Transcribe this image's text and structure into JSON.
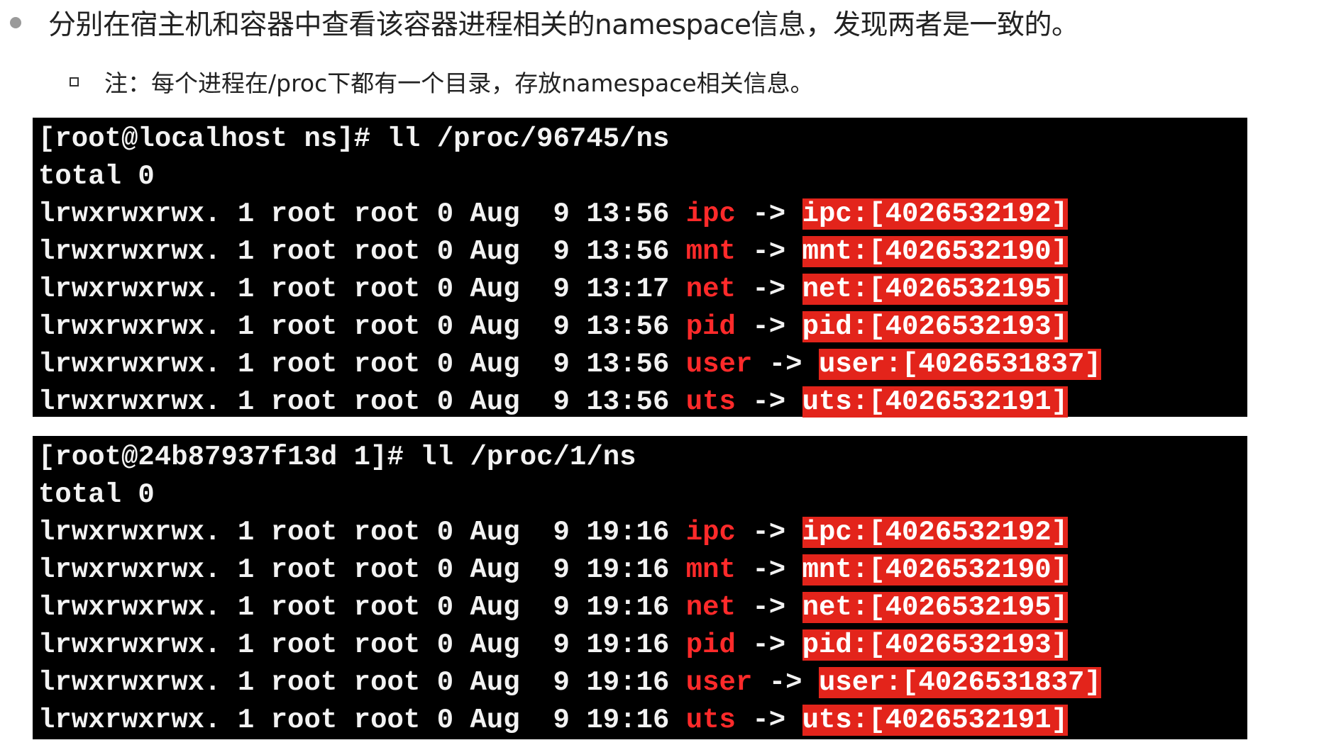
{
  "slide": {
    "bullet": "分别在宿主机和容器中查看该容器进程相关的namespace信息，发现两者是一致的。",
    "sub_bullet": "注：每个进程在/proc下都有一个目录，存放namespace相关信息。"
  },
  "colors": {
    "terminal_bg": "#000000",
    "terminal_text": "#f2f2f2",
    "ns_name": "#ff2a2a",
    "highlight": "#e3241b"
  },
  "host_terminal": {
    "command": "[root@localhost ns]# ll /proc/96745/ns",
    "total": "total 0",
    "rows": [
      {
        "prefix": "lrwxrwxrwx. 1 root root 0 Aug  9 13:56 ",
        "name": "ipc",
        "arrow": " -> ",
        "target": "ipc:[4026532192]"
      },
      {
        "prefix": "lrwxrwxrwx. 1 root root 0 Aug  9 13:56 ",
        "name": "mnt",
        "arrow": " -> ",
        "target": "mnt:[4026532190]"
      },
      {
        "prefix": "lrwxrwxrwx. 1 root root 0 Aug  9 13:17 ",
        "name": "net",
        "arrow": " -> ",
        "target": "net:[4026532195]"
      },
      {
        "prefix": "lrwxrwxrwx. 1 root root 0 Aug  9 13:56 ",
        "name": "pid",
        "arrow": " -> ",
        "target": "pid:[4026532193]"
      },
      {
        "prefix": "lrwxrwxrwx. 1 root root 0 Aug  9 13:56 ",
        "name": "user",
        "arrow": " -> ",
        "target": "user:[4026531837]"
      },
      {
        "prefix": "lrwxrwxrwx. 1 root root 0 Aug  9 13:56 ",
        "name": "uts",
        "arrow": " -> ",
        "target": "uts:[4026532191]"
      }
    ]
  },
  "container_terminal": {
    "command": "[root@24b87937f13d 1]# ll /proc/1/ns",
    "total": "total 0",
    "rows": [
      {
        "prefix": "lrwxrwxrwx. 1 root root 0 Aug  9 19:16 ",
        "name": "ipc",
        "arrow": " -> ",
        "target": "ipc:[4026532192]"
      },
      {
        "prefix": "lrwxrwxrwx. 1 root root 0 Aug  9 19:16 ",
        "name": "mnt",
        "arrow": " -> ",
        "target": "mnt:[4026532190]"
      },
      {
        "prefix": "lrwxrwxrwx. 1 root root 0 Aug  9 19:16 ",
        "name": "net",
        "arrow": " -> ",
        "target": "net:[4026532195]"
      },
      {
        "prefix": "lrwxrwxrwx. 1 root root 0 Aug  9 19:16 ",
        "name": "pid",
        "arrow": " -> ",
        "target": "pid:[4026532193]"
      },
      {
        "prefix": "lrwxrwxrwx. 1 root root 0 Aug  9 19:16 ",
        "name": "user",
        "arrow": " -> ",
        "target": "user:[4026531837]"
      },
      {
        "prefix": "lrwxrwxrwx. 1 root root 0 Aug  9 19:16 ",
        "name": "uts",
        "arrow": " -> ",
        "target": "uts:[4026532191]"
      }
    ]
  }
}
